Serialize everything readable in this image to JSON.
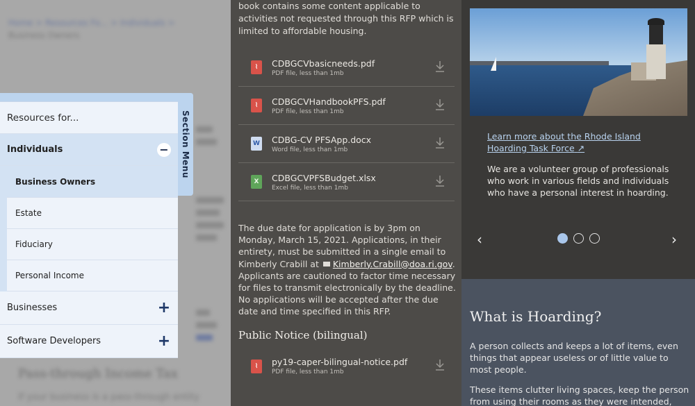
{
  "left": {
    "breadcrumb": "Home > Resources Fo... > Individuals >",
    "breadcrumb_sub": "Business Owners",
    "bg_heading": "Pass-through Income Tax",
    "bg_para": "If your business is a pass-through entity",
    "section_menu_label": "Section Menu",
    "menu": {
      "resources": "Resources for...",
      "individuals": "Individuals",
      "individuals_toggle": "−",
      "subitems": [
        "Business Owners",
        "Estate",
        "Fiduciary",
        "Personal Income"
      ],
      "businesses": "Businesses",
      "software": "Software Developers",
      "expand_symbol": "+"
    }
  },
  "middle": {
    "intro": "book contains some content applicable to activities not requested through this RFP which is limited to affordable housing.",
    "files": [
      {
        "name": "CDBGCVbasicneeds.pdf",
        "meta": "PDF file, less than 1mb",
        "type": "pdf"
      },
      {
        "name": "CDBGCVHandbookPFS.pdf",
        "meta": "PDF file, less than 1mb",
        "type": "pdf"
      },
      {
        "name": "CDBG-CV PFSApp.docx",
        "meta": "Word file, less than 1mb",
        "type": "doc"
      },
      {
        "name": "CDBGCVPFSBudget.xlsx",
        "meta": "Excel file, less than 1mb",
        "type": "xls"
      }
    ],
    "due_text_before": "The due date for application is by 3pm on Monday, March 15, 2021. Applications, in their entirety, must be submitted in a single email to Kimberly Crabill at",
    "email": "Kimberly.Crabill@doa.ri.gov",
    "due_text_after": ". Applicants are cautioned to factor time necessary for files to transmit electronically by the deadline. No applications will be accepted after the due date and time specified in this RFP.",
    "notice_heading": "Public Notice (bilingual)",
    "notice_file": {
      "name": "py19-caper-bilingual-notice.pdf",
      "meta": "PDF file, less than 1mb"
    }
  },
  "right": {
    "link": "Learn more about the Rhode Island Hoarding Task Force",
    "text": "We are a volunteer group of professionals who work in various fields and individuals who have a personal interest in hoarding.",
    "prev": "‹",
    "next": "›",
    "what_heading": "What is Hoarding?",
    "what_p1": "A person collects and keeps a lot of items, even things that appear useless or of little value to most people.",
    "what_p2": "These items clutter living spaces, keep the person from using their rooms as they were intended,"
  },
  "colors": {
    "accent_blue": "#bcd4ee",
    "pdf_red": "#d9534a",
    "xls_green": "#5fa55a"
  }
}
